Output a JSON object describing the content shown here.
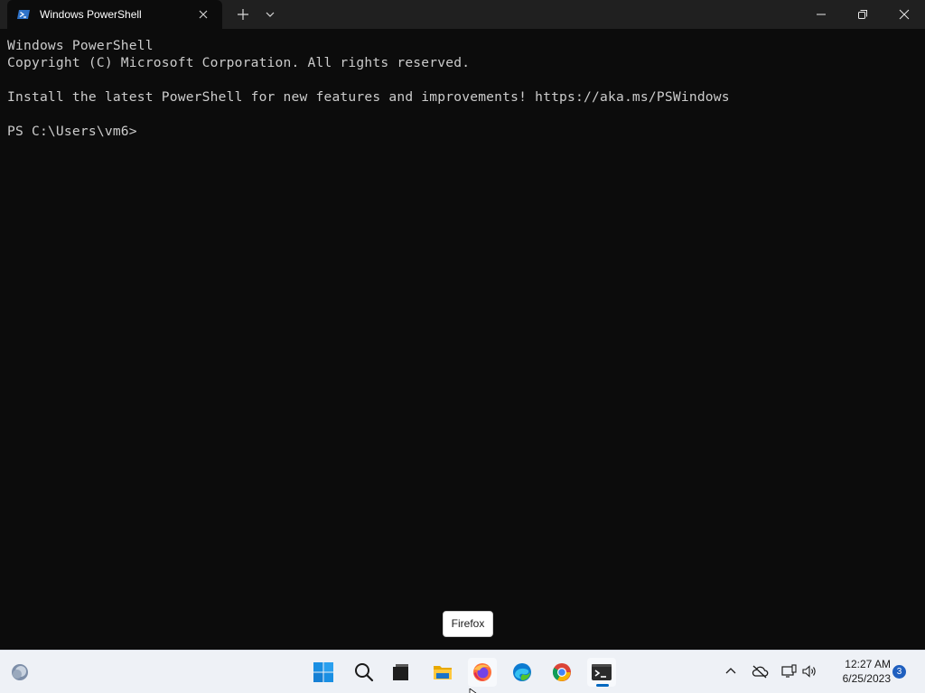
{
  "window": {
    "tab_title": "Windows PowerShell",
    "tab_icon": "powershell-icon",
    "controls": [
      "minimize-icon",
      "maximize-icon",
      "close-icon"
    ]
  },
  "terminal": {
    "lines": [
      "Windows PowerShell",
      "Copyright (C) Microsoft Corporation. All rights reserved.",
      "Install the latest PowerShell for new features and improvements! https://aka.ms/PSWindows",
      "PS C:\\Users\\vm6>"
    ],
    "background": "#0c0c0c",
    "foreground": "#cccccc"
  },
  "tooltip": {
    "text": "Firefox"
  },
  "taskbar": {
    "apps": [
      {
        "name": "Start",
        "icon": "windows-logo-icon"
      },
      {
        "name": "Search",
        "icon": "search-icon"
      },
      {
        "name": "Task View",
        "icon": "task-view-icon"
      },
      {
        "name": "File Explorer",
        "icon": "folder-icon"
      },
      {
        "name": "Firefox",
        "icon": "firefox-icon"
      },
      {
        "name": "Microsoft Edge",
        "icon": "edge-icon"
      },
      {
        "name": "Google Chrome",
        "icon": "chrome-icon"
      },
      {
        "name": "Terminal",
        "icon": "terminal-icon"
      }
    ],
    "tray": {
      "time": "12:27 AM",
      "date": "6/25/2023",
      "notification_count": "3"
    },
    "accent": "#0067c0"
  }
}
